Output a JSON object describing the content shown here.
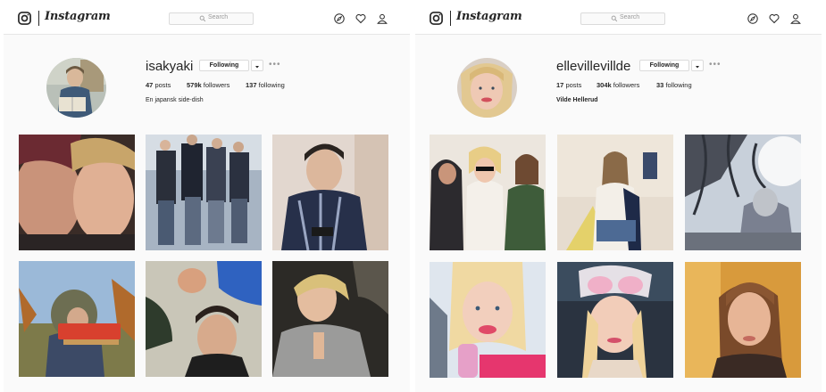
{
  "app": {
    "wordmark": "Instagram",
    "search_placeholder": "Search",
    "icons": [
      "instagram-glyph-icon",
      "search-icon",
      "explore-compass-icon",
      "activity-heart-icon",
      "profile-person-icon"
    ]
  },
  "profiles": [
    {
      "username": "isakyaki",
      "follow_label": "Following",
      "posts": {
        "value": "47",
        "label": "posts"
      },
      "followers": {
        "value": "579k",
        "label": "followers"
      },
      "following": {
        "value": "137",
        "label": "following"
      },
      "bio": "En japansk side-dish",
      "bio_bold": false
    },
    {
      "username": "ellevillevillde",
      "follow_label": "Following",
      "posts": {
        "value": "17",
        "label": "posts"
      },
      "followers": {
        "value": "304k",
        "label": "followers"
      },
      "following": {
        "value": "33",
        "label": "following"
      },
      "bio": "Vilde Hellerud",
      "bio_bold": true
    }
  ],
  "colors": {
    "text": "#262626",
    "muted": "#999999",
    "border": "#dbdbdb",
    "background": "#fafafa"
  }
}
